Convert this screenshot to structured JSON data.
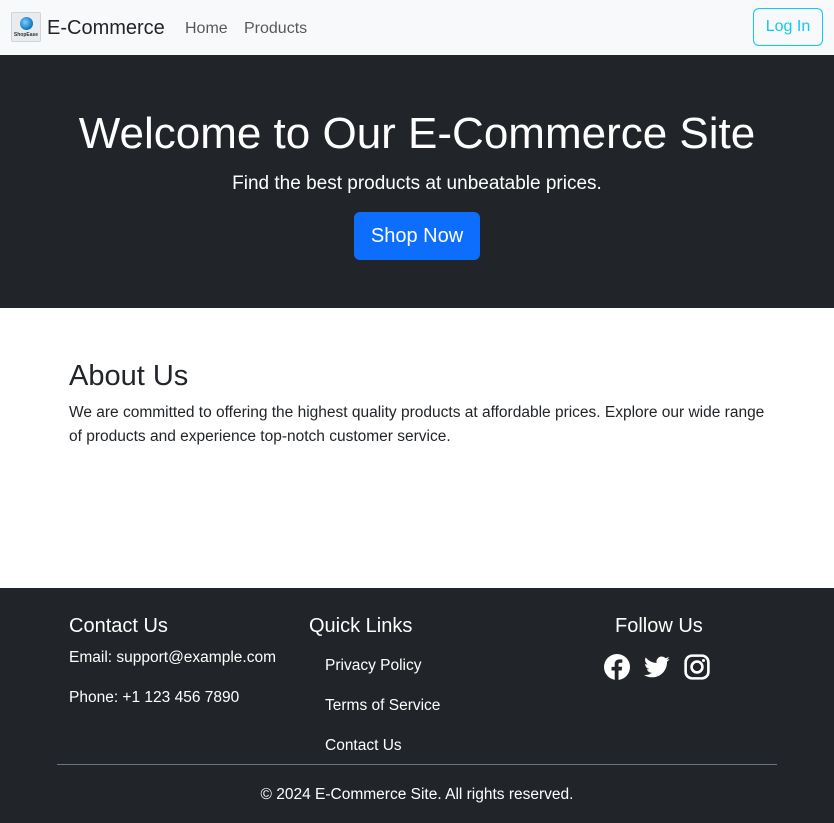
{
  "navbar": {
    "logo_text": "ShopEase",
    "brand": "E-Commerce",
    "links": [
      {
        "label": "Home"
      },
      {
        "label": "Products"
      }
    ],
    "login_label": "Log In",
    "login_color": "#0dcaf0"
  },
  "hero": {
    "title": "Welcome to Our E-Commerce Site",
    "subtitle": "Find the best products at unbeatable prices.",
    "cta_label": "Shop Now",
    "cta_color": "#0d6efd",
    "background": "#212529"
  },
  "about": {
    "title": "About Us",
    "text": "We are committed to offering the highest quality products at affordable prices. Explore our wide range of products and experience top-notch customer service."
  },
  "footer": {
    "contact": {
      "title": "Contact Us",
      "email": "Email: support@example.com",
      "phone": "Phone: +1 123 456 7890"
    },
    "quick_links": {
      "title": "Quick Links",
      "items": [
        {
          "label": "Privacy Policy"
        },
        {
          "label": "Terms of Service"
        },
        {
          "label": "Contact Us"
        }
      ]
    },
    "follow": {
      "title": "Follow Us",
      "icons": [
        "facebook-icon",
        "twitter-icon",
        "instagram-icon"
      ]
    },
    "copyright": "© 2024 E-Commerce Site. All rights reserved."
  }
}
